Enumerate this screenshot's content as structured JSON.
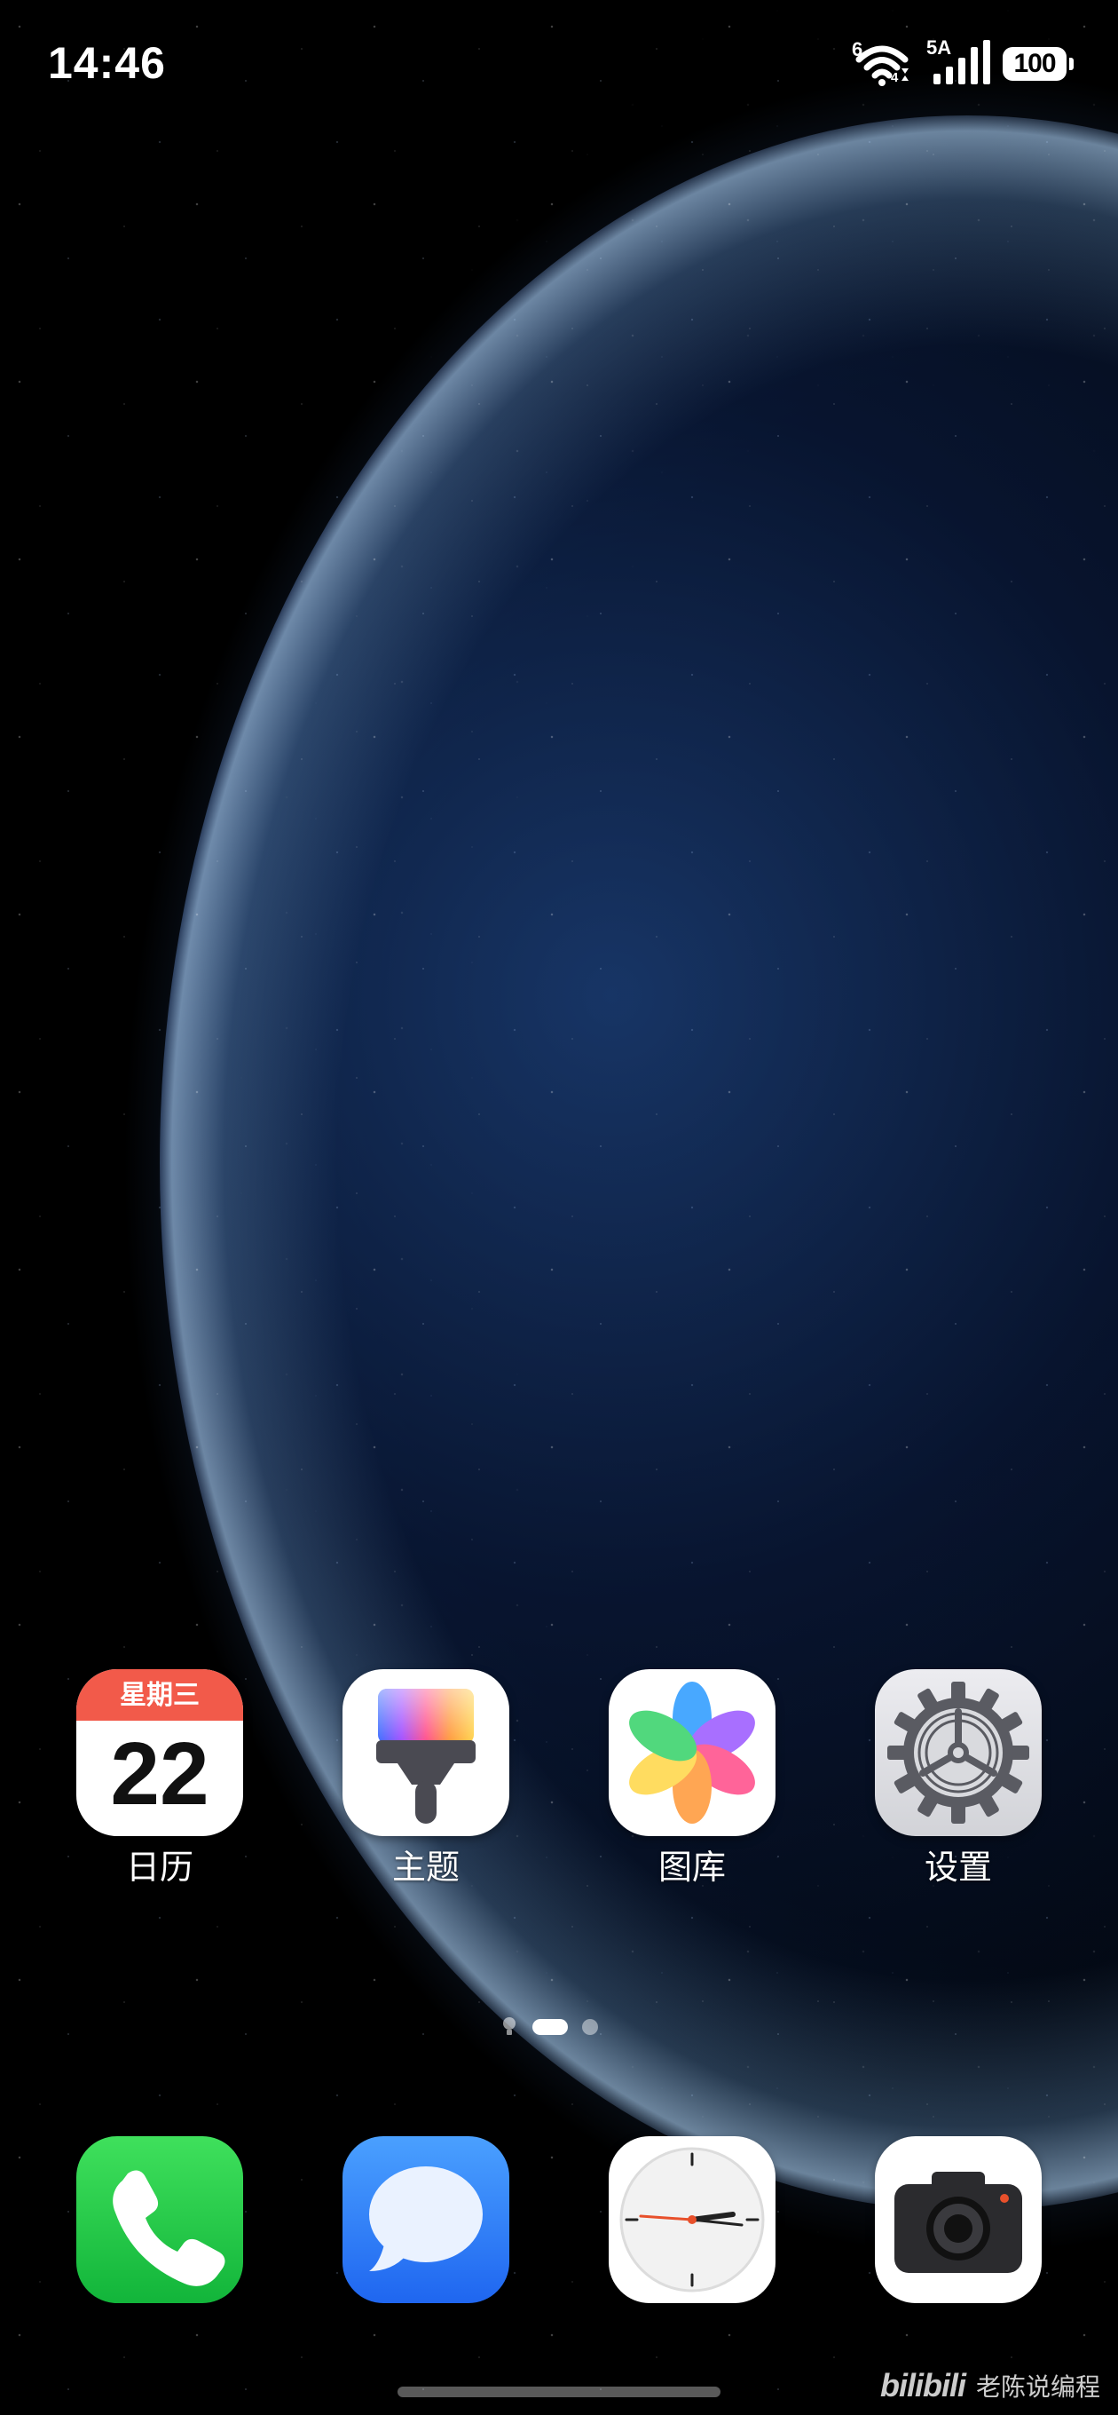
{
  "status_bar": {
    "time": "14:46",
    "wifi_label": "6",
    "wifi_sub": "4",
    "cellular_label": "5A",
    "battery": "100"
  },
  "home_apps": [
    {
      "label": "日历",
      "icon": "calendar-icon",
      "calendar_weekday": "星期三",
      "calendar_date": "22"
    },
    {
      "label": "主题",
      "icon": "themes-brush-icon"
    },
    {
      "label": "图库",
      "icon": "gallery-petal-icon"
    },
    {
      "label": "设置",
      "icon": "settings-gear-icon"
    }
  ],
  "page_indicator": {
    "pages": 2,
    "current": 1,
    "has_leftmost_card_page": true
  },
  "dock": [
    {
      "name": "phone",
      "icon": "phone-icon"
    },
    {
      "name": "messages",
      "icon": "message-icon"
    },
    {
      "name": "clock",
      "icon": "clock-icon"
    },
    {
      "name": "camera",
      "icon": "camera-icon"
    }
  ],
  "watermark": {
    "brand": "bilibili",
    "author": "老陈说编程"
  },
  "colors": {
    "calendar_header": "#f25a4a",
    "phone_green": "#12b53a",
    "messages_blue": "#1f66f0"
  }
}
